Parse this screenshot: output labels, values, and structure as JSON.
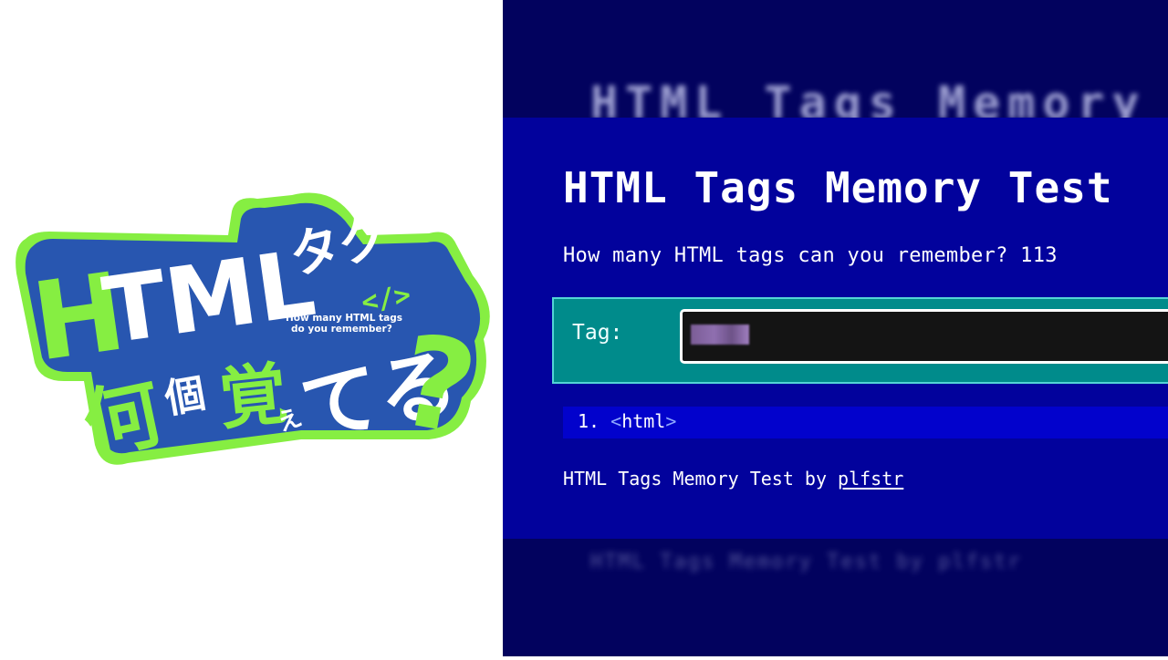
{
  "logo": {
    "title_latin": "HTML",
    "title_tag": "タグ",
    "title_line2_a": "何",
    "title_line2_b": "個",
    "title_line2_c": "覚",
    "title_line2_d": "え",
    "title_line2_e": "てる",
    "title_question": "?",
    "tag_glyph": "</>",
    "subtitle_line1": "How many HTML tags",
    "subtitle_line2": "do you remember?",
    "colors": {
      "blue": "#2856b0",
      "green": "#86ee42",
      "white": "#ffffff"
    }
  },
  "screenshot": {
    "ghost_title": "HTML Tags Memory Test",
    "ghost_footer": "HTML Tags Memory Test by plfstr",
    "page_title": "HTML Tags Memory Test",
    "subtitle": "How many HTML tags can you remember? 113",
    "form": {
      "label": "Tag:",
      "input_value": "",
      "input_redacted": true
    },
    "answers": [
      {
        "index": "1.",
        "open": "<",
        "tag": "html",
        "close": ">"
      }
    ],
    "footer": {
      "text": "HTML Tags Memory Test by ",
      "link": "plfstr"
    },
    "colors": {
      "outer_bg": "#02025e",
      "page_bg": "#02029c",
      "form_bg": "#008b8b",
      "input_bg": "#141414",
      "list_bg": "#0202cc"
    }
  }
}
